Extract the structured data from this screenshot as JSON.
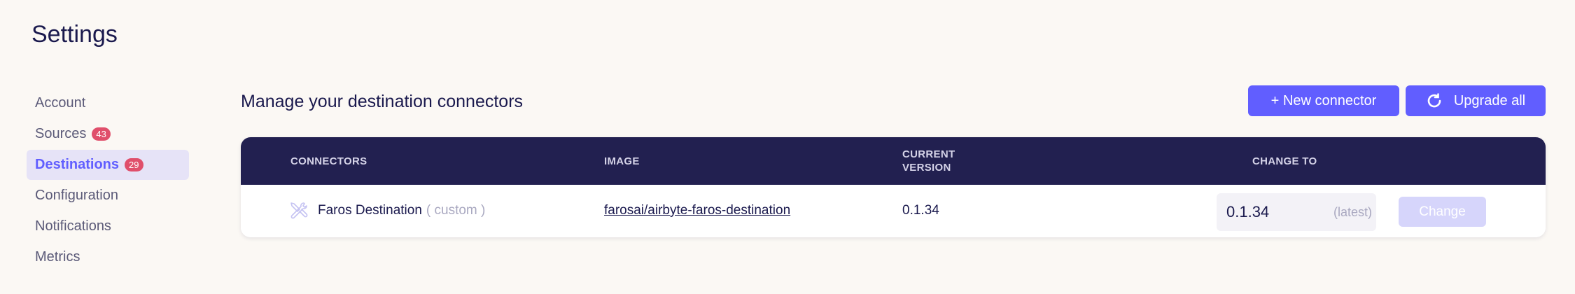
{
  "page": {
    "title": "Settings"
  },
  "sidebar": {
    "items": [
      {
        "label": "Account",
        "badge": null,
        "active": false
      },
      {
        "label": "Sources",
        "badge": "43",
        "active": false
      },
      {
        "label": "Destinations",
        "badge": "29",
        "active": true
      },
      {
        "label": "Configuration",
        "badge": null,
        "active": false
      },
      {
        "label": "Notifications",
        "badge": null,
        "active": false
      },
      {
        "label": "Metrics",
        "badge": null,
        "active": false
      }
    ]
  },
  "main": {
    "heading": "Manage your destination connectors",
    "new_connector_label": "+ New connector",
    "upgrade_all_label": "Upgrade all"
  },
  "table": {
    "headers": {
      "connectors": "CONNECTORS",
      "image": "IMAGE",
      "current_version": "CURRENT VERSION",
      "change_to": "CHANGE TO"
    },
    "rows": [
      {
        "name": "Faros Destination",
        "tag": "( custom )",
        "image": "farosai/airbyte-faros-destination",
        "current_version": "0.1.34",
        "change_to_version": "0.1.34",
        "change_to_note": "(latest)",
        "change_label": "Change"
      }
    ]
  },
  "colors": {
    "accent": "#615eff",
    "header_bg": "#222050",
    "badge": "#e04f6b",
    "page_bg": "#fbf8f4"
  },
  "icons": {
    "upgrade": "refresh-icon",
    "connector": "tools-icon"
  }
}
